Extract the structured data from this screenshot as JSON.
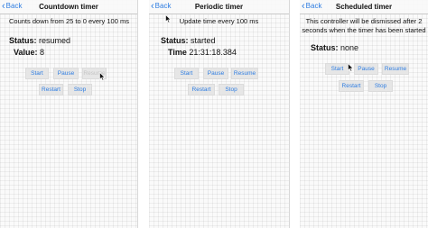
{
  "colors": {
    "accent": "#2f7de1",
    "button_bg": "#e6e6e6",
    "disabled_text": "#c4c4c4"
  },
  "panels": [
    {
      "back_label": "Back",
      "title": "Countdown timer",
      "description": "Counts down from 25 to 0 every 100 ms",
      "status_label": "Status:",
      "status_value": "resumed",
      "value_label": "Value:",
      "value_value": "8",
      "buttons": {
        "start": "Start",
        "pause": "Pause",
        "resume": "Resume",
        "restart": "Restart",
        "stop": "Stop"
      }
    },
    {
      "back_label": "Back",
      "title": "Periodic timer",
      "description": "Update time every 100 ms",
      "status_label": "Status:",
      "status_value": "started",
      "time_label": "Time",
      "time_value": "21:31:18.384",
      "buttons": {
        "start": "Start",
        "pause": "Pause",
        "resume": "Resume",
        "restart": "Restart",
        "stop": "Stop"
      }
    },
    {
      "back_label": "Back",
      "title": "Scheduled timer",
      "description_line1": "This controller will be dismissed after 2",
      "description_line2": "seconds when the timer has been started",
      "status_label": "Status:",
      "status_value": "none",
      "buttons": {
        "start": "Start",
        "pause": "Pause",
        "resume": "Resume",
        "restart": "Restart",
        "stop": "Stop"
      }
    }
  ]
}
